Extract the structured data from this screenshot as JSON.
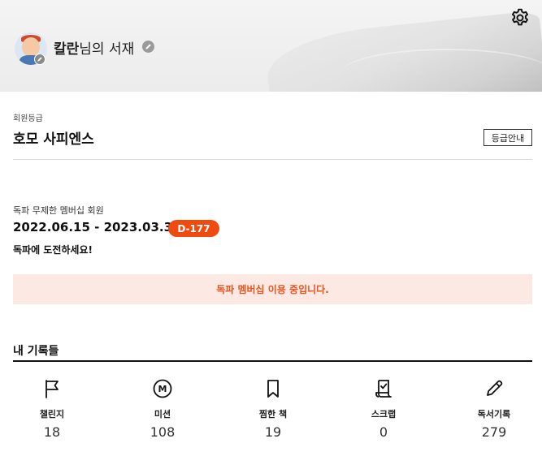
{
  "header": {
    "user_name": "칼란",
    "shelf_suffix": "님의 서재"
  },
  "grade": {
    "label": "회원등급",
    "name": "호모 사피엔스",
    "guide_button": "등급안내"
  },
  "membership": {
    "label": "독파 무제한 멤버십 회원",
    "period": "2022.06.15 - 2023.03.31",
    "dday": "D-177",
    "challenge_text": "독파에 도전하세요!",
    "notice": "독파 멤버십 이용 중입니다.",
    "accent_color": "#ef4a0f"
  },
  "records": {
    "title": "내 기록들",
    "items": [
      {
        "icon": "flag-icon",
        "label": "챌린지",
        "value": "18"
      },
      {
        "icon": "mission-icon",
        "label": "미션",
        "value": "108"
      },
      {
        "icon": "bookmark-icon",
        "label": "찜한 책",
        "value": "19"
      },
      {
        "icon": "scrap-icon",
        "label": "스크랩",
        "value": "0"
      },
      {
        "icon": "pencil-icon",
        "label": "독서기록",
        "value": "279"
      }
    ]
  }
}
